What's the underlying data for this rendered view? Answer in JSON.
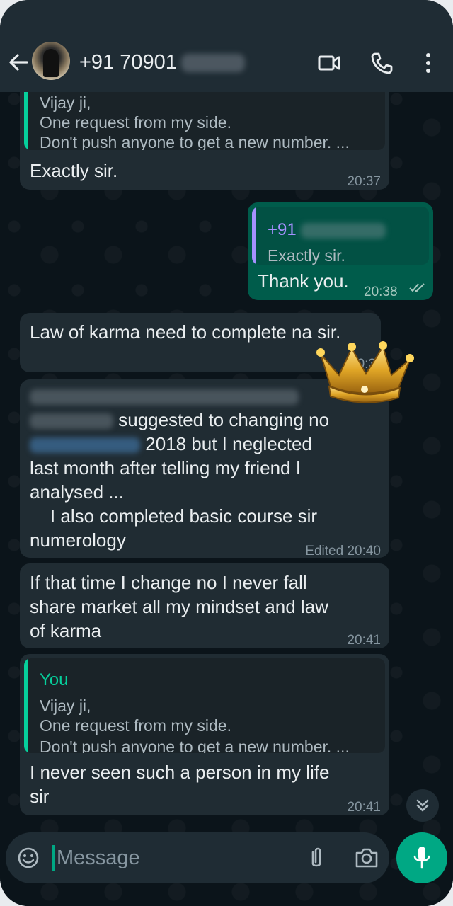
{
  "header": {
    "contact_name": "+91 70901",
    "icons": [
      "back-arrow-icon",
      "avatar",
      "video-call-icon",
      "voice-call-icon",
      "more-options-icon"
    ]
  },
  "messages": [
    {
      "direction": "in",
      "quote": {
        "line1": "Vijay ji,",
        "line2": "One request from my side.",
        "line3": "Don't push anyone to get a new number. ..."
      },
      "text": "Exactly sir.",
      "time": "20:37"
    },
    {
      "direction": "out",
      "quote": {
        "author": "+91",
        "text": "Exactly sir."
      },
      "text": "Thank you.",
      "time": "20:38",
      "status": "read"
    },
    {
      "direction": "in",
      "text": "Law of karma need to complete na sir.",
      "time": "20:39"
    },
    {
      "direction": "in",
      "line1": "suggested to changing no",
      "line2": "2018 but I neglected",
      "line3": "last month after telling my friend I",
      "line4": "analysed ...",
      "line5": "    I also completed basic course sir",
      "line6": "numerology",
      "time": "Edited 20:40"
    },
    {
      "direction": "in",
      "line1": "If that time I change no I never fall",
      "line2": "share market all my mindset and law",
      "line3": "of karma",
      "time": "20:41"
    },
    {
      "direction": "in",
      "quote": {
        "author": "You",
        "line1": "Vijay ji,",
        "line2": "One request from my side.",
        "line3": "Don't push anyone to get a new number. ..."
      },
      "line1": "I never seen such a person in my life",
      "line2": "sir",
      "time": "20:41"
    }
  ],
  "composer": {
    "placeholder": "Message"
  },
  "colors": {
    "header_bg": "#1f2c34",
    "chat_bg": "#0b141a",
    "incoming_bubble": "#202c33",
    "outgoing_bubble": "#005c4b",
    "accent_green": "#00a884",
    "quote_purple": "#a591ff"
  }
}
